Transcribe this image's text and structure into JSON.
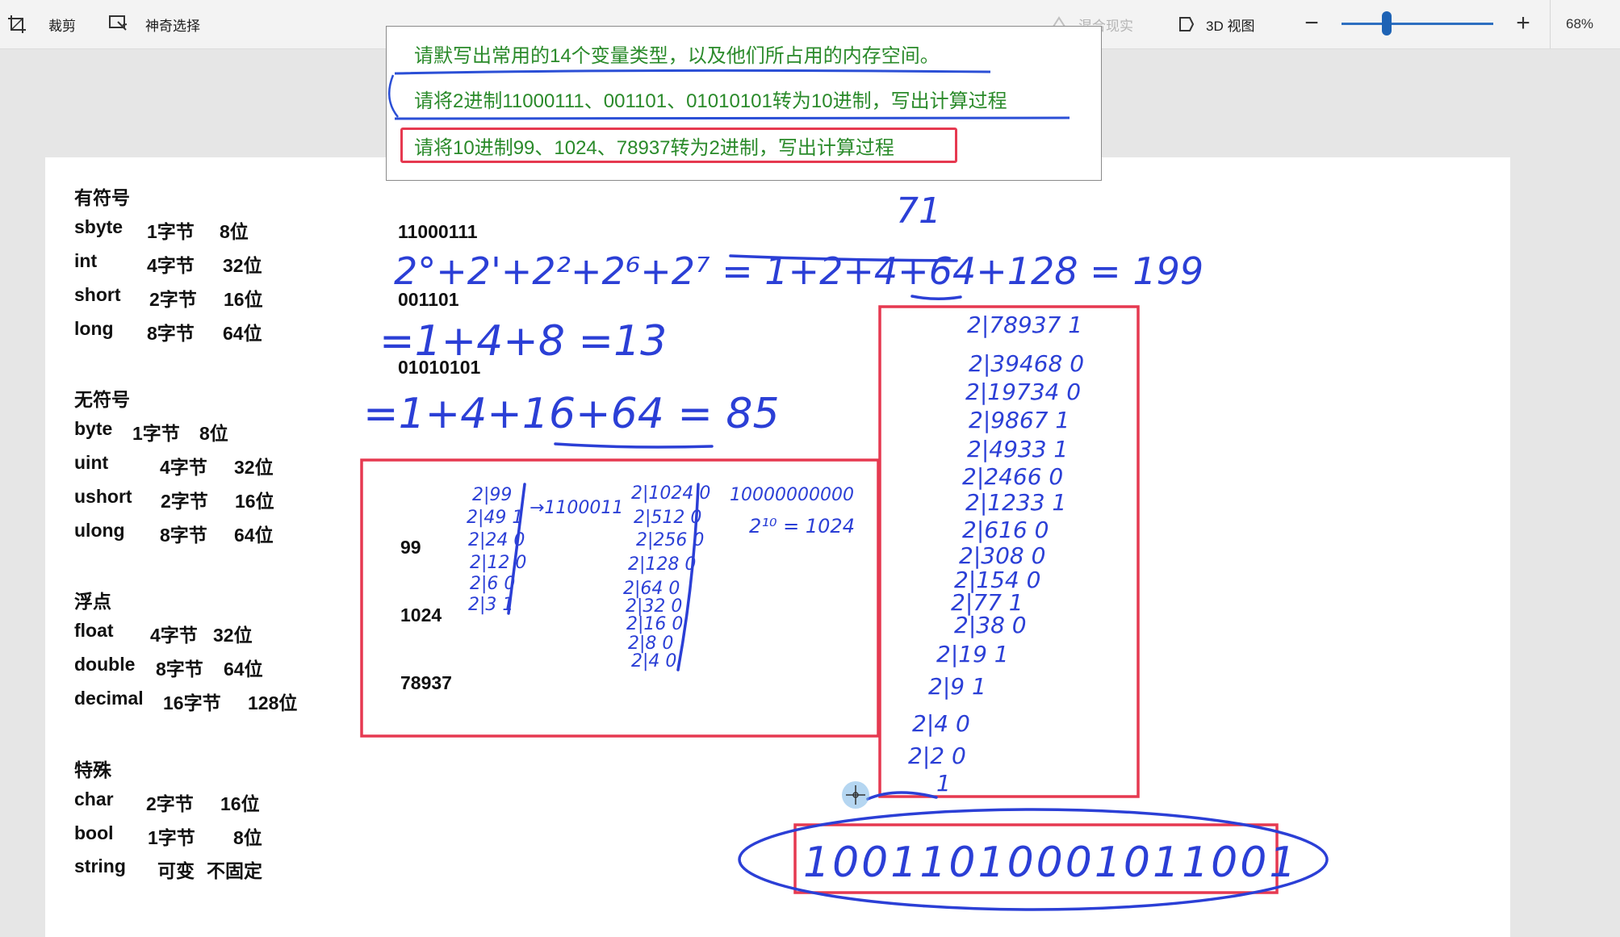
{
  "toolbar": {
    "crop_label": "裁剪",
    "magic_select_label": "神奇选择",
    "mixed_reality_label": "混合现实",
    "view3d_label": "3D 视图",
    "zoom_out_symbol": "−",
    "zoom_in_symbol": "+",
    "zoom_level": "68%",
    "zoom_fraction": 0.3
  },
  "questions": [
    "请默写出常用的14个变量类型，以及他们所占用的内存空间。",
    "请将2进制11000111、001101、01010101转为10进制，写出计算过程",
    "请将10进制99、1024、78937转为2进制，写出计算过程"
  ],
  "type_groups": [
    {
      "heading": "有符号",
      "rows": [
        [
          "sbyte",
          "1字节",
          "8位"
        ],
        [
          "int",
          "4字节",
          "32位"
        ],
        [
          "short",
          "2字节",
          "16位"
        ],
        [
          "long",
          "8字节",
          "64位"
        ]
      ]
    },
    {
      "heading": "无符号",
      "rows": [
        [
          "byte",
          "1字节",
          "8位"
        ],
        [
          "uint",
          "4字节",
          "32位"
        ],
        [
          "ushort",
          "2字节",
          "16位"
        ],
        [
          "ulong",
          "8字节",
          "64位"
        ]
      ]
    },
    {
      "heading": "浮点",
      "rows": [
        [
          "float",
          "4字节",
          "32位"
        ],
        [
          "double",
          "8字节",
          "64位"
        ],
        [
          "decimal",
          "16字节",
          "128位"
        ]
      ]
    },
    {
      "heading": "特殊",
      "rows": [
        [
          "char",
          "2字节",
          "16位"
        ],
        [
          "bool",
          "1字节",
          "8位"
        ],
        [
          "string",
          "可变",
          "不固定"
        ]
      ]
    }
  ],
  "binary_inputs": [
    "11000111",
    "001101",
    "01010101"
  ],
  "decimal_inputs": [
    "99",
    "1024",
    "78937"
  ],
  "handwriting": {
    "top_note": "71",
    "calc_199": "2°+2'+2²+2⁶+2⁷ = 1+2+4+64+128 = 199",
    "calc_13": "=1+4+8 =13",
    "calc_85": "=1+4+16+64 = 85",
    "bin_99": "→1100011",
    "bin_1024": "10000000000",
    "pow_1024": "2¹⁰ = 1024",
    "bin_78937": "10011010001011001",
    "colors": {
      "ink": "#2b3fd6",
      "highlight_box": "#e63950",
      "question_text": "#2a8a2a"
    }
  }
}
